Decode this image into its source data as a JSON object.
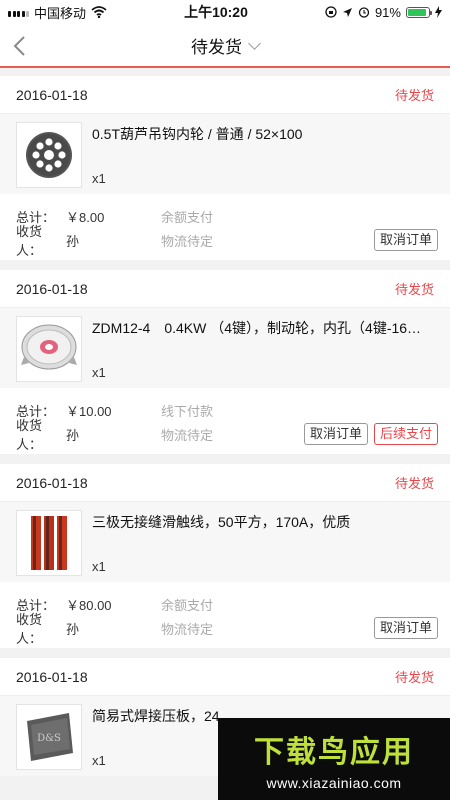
{
  "status_bar": {
    "carrier": "中国移动",
    "time": "上午10:20",
    "battery": "91%",
    "battery_level": 0.91
  },
  "nav": {
    "title": "待发货"
  },
  "orders": [
    {
      "date": "2016-01-18",
      "status": "待发货",
      "item_name": "0.5T葫芦吊钩内轮 / 普通 / 52×100",
      "qty": "x1",
      "total_label": "总计：",
      "total": "￥8.00",
      "payment": "余额支付",
      "receiver_label": "收货人：",
      "receiver": "孙",
      "logistics": "物流待定",
      "cancel_label": "取消订单"
    },
    {
      "date": "2016-01-18",
      "status": "待发货",
      "item_name": "ZDM12-4　0.4KW （4键），制动轮，内孔（4键-16…",
      "qty": "x1",
      "total_label": "总计：",
      "total": "￥10.00",
      "payment": "线下付款",
      "receiver_label": "收货人：",
      "receiver": "孙",
      "logistics": "物流待定",
      "cancel_label": "取消订单",
      "followup_label": "后续支付"
    },
    {
      "date": "2016-01-18",
      "status": "待发货",
      "item_name": "三极无接缝滑触线，50平方，170A，优质",
      "qty": "x1",
      "total_label": "总计：",
      "total": "￥80.00",
      "payment": "余额支付",
      "receiver_label": "收货人：",
      "receiver": "孙",
      "logistics": "物流待定",
      "cancel_label": "取消订单"
    },
    {
      "date": "2016-01-18",
      "status": "待发货",
      "item_name": "简易式焊接压板，24",
      "qty": "x1"
    }
  ],
  "watermark": {
    "title": "下载鸟应用",
    "url": "www.xiazainiao.com"
  },
  "colors": {
    "accent_red": "#e5484d",
    "battery_green": "#2fc45a",
    "watermark_green": "#bfe03a"
  }
}
